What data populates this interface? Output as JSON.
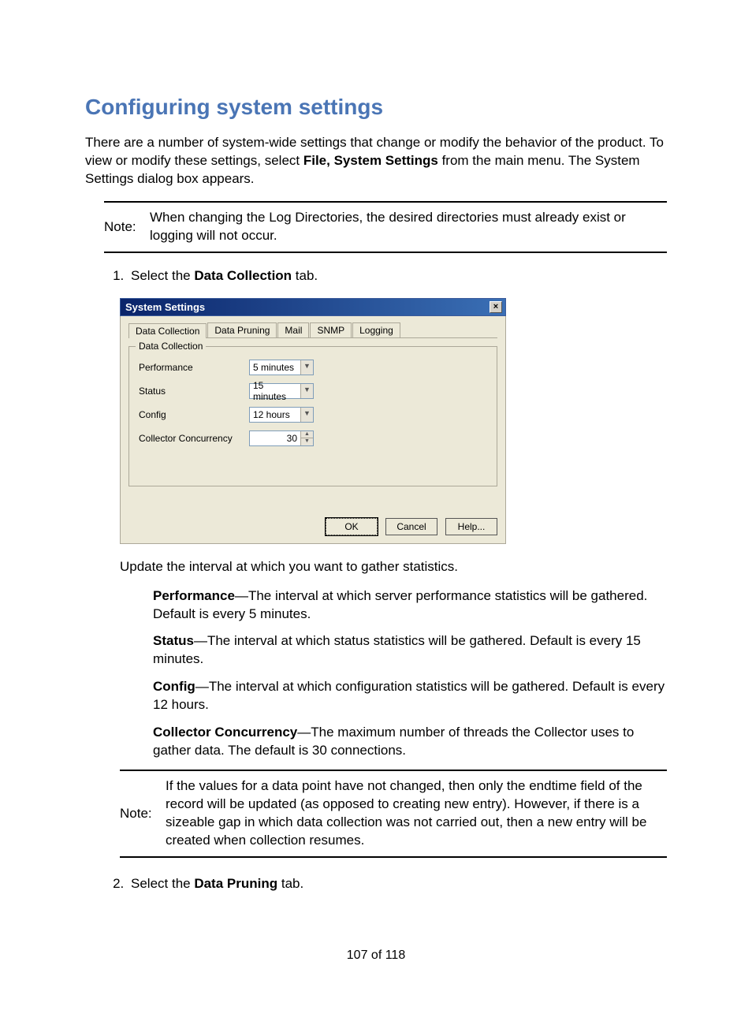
{
  "heading": "Configuring system settings",
  "intro_1": "There are a number of system-wide settings that change or modify the behavior of the product. To view or modify these settings, select ",
  "intro_bold": "File, System Settings",
  "intro_2": " from the main menu. The System Settings dialog box appears.",
  "note1": {
    "label": "Note:",
    "text": "When changing the Log Directories, the desired directories must already exist or logging will not occur."
  },
  "step1_a": "Select the ",
  "step1_bold": "Data Collection",
  "step1_b": " tab.",
  "dialog": {
    "title": "System Settings",
    "close": "×",
    "tabs": [
      "Data Collection",
      "Data Pruning",
      "Mail",
      "SNMP",
      "Logging"
    ],
    "group_legend": "Data Collection",
    "rows": {
      "performance": {
        "label": "Performance",
        "value": "5 minutes"
      },
      "status": {
        "label": "Status",
        "value": "15 minutes"
      },
      "config": {
        "label": "Config",
        "value": "12 hours"
      },
      "concurrency": {
        "label": "Collector Concurrency",
        "value": "30"
      }
    },
    "buttons": {
      "ok": "OK",
      "cancel": "Cancel",
      "help": "Help..."
    }
  },
  "update_text": "Update the interval at which you want to gather statistics.",
  "defs": {
    "perf_t": "Performance",
    "perf_d": "—The interval at which server performance statistics will be gathered. Default is every 5 minutes.",
    "status_t": "Status",
    "status_d": "—The interval at which status statistics will be gathered. Default is every 15 minutes.",
    "config_t": "Config",
    "config_d": "—The interval at which configuration statistics will be gathered. Default is every 12 hours.",
    "cc_t": "Collector Concurrency",
    "cc_d": "—The maximum number of threads the Collector uses to gather data. The default is 30 connections."
  },
  "note2": {
    "label": "Note:",
    "text": "If the values for a data point have not changed, then only the endtime field of the record will be updated (as opposed to creating new entry). However, if there is a sizeable gap in which data collection was not carried out, then a new entry will be created when collection resumes."
  },
  "step2_a": "Select the ",
  "step2_bold": "Data Pruning",
  "step2_b": " tab.",
  "page_number": "107 of 118"
}
